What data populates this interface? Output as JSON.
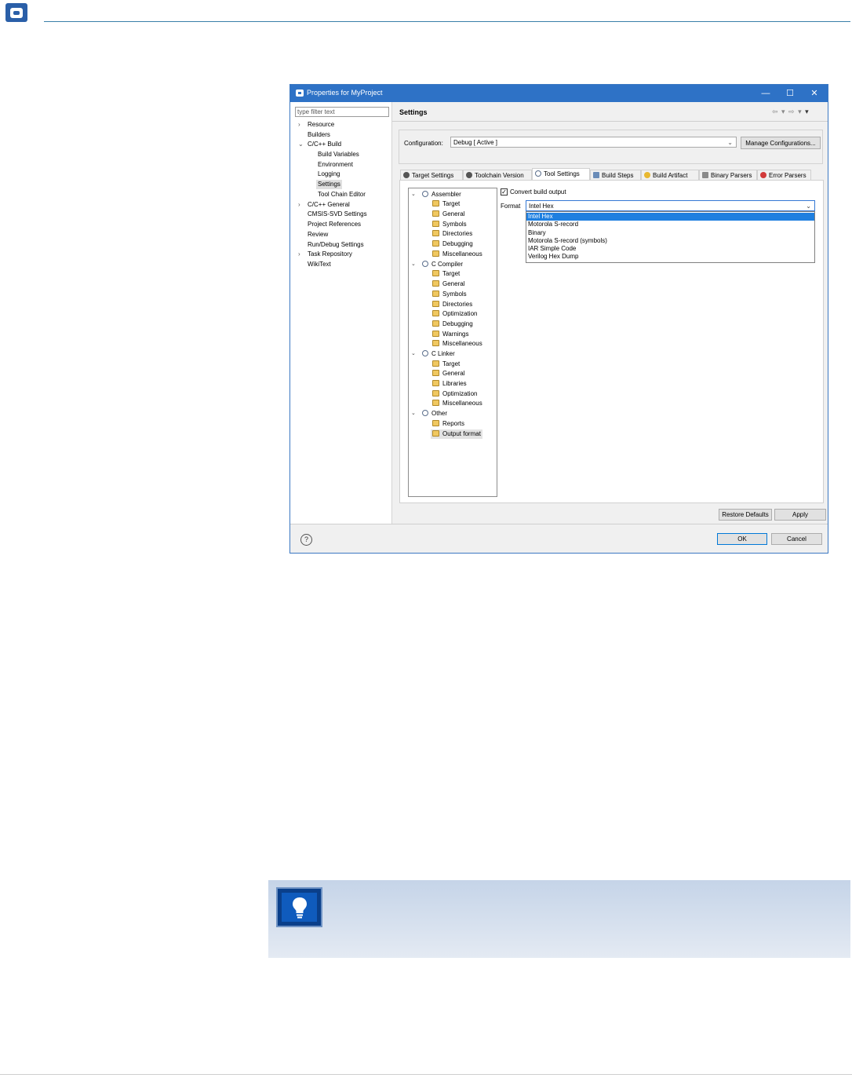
{
  "dialog": {
    "title": "Properties for MyProject",
    "controls": {
      "minimize": "—",
      "maximize": "☐",
      "close": "✕"
    }
  },
  "left_nav": {
    "filter_placeholder": "type filter text",
    "items": [
      {
        "label": "Resource",
        "expandable": true
      },
      {
        "label": "Builders"
      },
      {
        "label": "C/C++ Build",
        "expanded": true
      },
      {
        "label": "Build Variables"
      },
      {
        "label": "Environment"
      },
      {
        "label": "Logging"
      },
      {
        "label": "Settings",
        "selected": true
      },
      {
        "label": "Tool Chain Editor"
      },
      {
        "label": "C/C++ General",
        "expandable": true
      },
      {
        "label": "CMSIS-SVD Settings"
      },
      {
        "label": "Project References"
      },
      {
        "label": "Review"
      },
      {
        "label": "Run/Debug Settings"
      },
      {
        "label": "Task Repository",
        "expandable": true
      },
      {
        "label": "WikiText"
      }
    ]
  },
  "main": {
    "title": "Settings",
    "configuration_label": "Configuration:",
    "configuration_value": "Debug  [ Active ]",
    "manage_button": "Manage Configurations...",
    "tabs": [
      {
        "label": "Target Settings"
      },
      {
        "label": "Toolchain Version"
      },
      {
        "label": "Tool Settings",
        "active": true
      },
      {
        "label": "Build Steps"
      },
      {
        "label": "Build Artifact"
      },
      {
        "label": "Binary Parsers"
      },
      {
        "label": "Error Parsers"
      }
    ],
    "tree": {
      "groups": [
        {
          "label": "Assembler",
          "children": [
            "Target",
            "General",
            "Symbols",
            "Directories",
            "Debugging",
            "Miscellaneous"
          ]
        },
        {
          "label": "C Compiler",
          "children": [
            "Target",
            "General",
            "Symbols",
            "Directories",
            "Optimization",
            "Debugging",
            "Warnings",
            "Miscellaneous"
          ]
        },
        {
          "label": "C Linker",
          "children": [
            "Target",
            "General",
            "Libraries",
            "Optimization",
            "Miscellaneous"
          ]
        },
        {
          "label": "Other",
          "children": [
            "Reports",
            "Output format"
          ]
        }
      ],
      "selected": "Output format"
    },
    "convert_checkbox": {
      "label": "Convert build output",
      "checked": true,
      "mark": "✓"
    },
    "format": {
      "label": "Format",
      "value": "Intel Hex",
      "options": [
        "Intel Hex",
        "Motorola S-record",
        "Binary",
        "Motorola S-record (symbols)",
        "IAR Simple Code",
        "Verilog Hex Dump"
      ]
    },
    "restore_defaults": "Restore Defaults",
    "apply": "Apply"
  },
  "footer": {
    "help_icon": "?",
    "ok": "OK",
    "cancel": "Cancel"
  },
  "colors": {
    "titlebar": "#2e72c6",
    "selection": "#1e7fe0",
    "tip_icon": "#0a3f8a",
    "page_logo": "#2a5fa8"
  },
  "icons": {
    "page_logo": "logo-icon",
    "tip": "lightbulb-icon"
  }
}
